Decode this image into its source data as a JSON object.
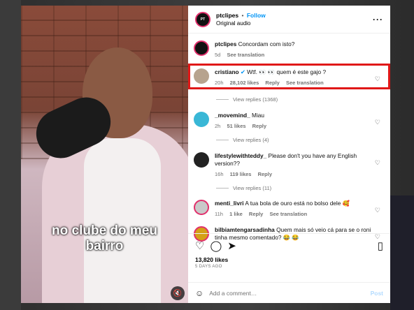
{
  "post": {
    "username": "ptclipes",
    "follow_label": "Follow",
    "audio": "Original audio",
    "avatar_text": "PT CLIPES",
    "caption_overlay_line1": "no clube do meu",
    "caption_overlay_line2": "bairro"
  },
  "comments": [
    {
      "user": "ptclipes",
      "text": "Concordam com isto?",
      "time": "5d",
      "likes": "",
      "reply": "",
      "translation": "See translation"
    },
    {
      "user": "cristiano",
      "verified": true,
      "text": "Wtf. 👀 👀 quem é este gajo ?",
      "time": "20h",
      "likes": "28,102 likes",
      "reply": "Reply",
      "translation": "See translation",
      "view_replies": "View replies (1368)"
    },
    {
      "user": "_movemind_",
      "text": "Miau",
      "time": "2h",
      "likes": "51 likes",
      "reply": "Reply",
      "view_replies": "View replies (4)"
    },
    {
      "user": "lifestylewithteddy_",
      "text": "Please don't you have any English version??",
      "time": "16h",
      "likes": "119 likes",
      "reply": "Reply",
      "view_replies": "View replies (11)"
    },
    {
      "user": "menti_livri",
      "text": "A tua bola de ouro está no bolso dele 🥰",
      "time": "11h",
      "likes": "1 like",
      "reply": "Reply",
      "translation": "See translation"
    },
    {
      "user": "bilbiamtengarsadinha",
      "text": "Quem mais só veio cá para se o roni tinha mesmo comentado? 😂 😂",
      "time": "",
      "likes": "",
      "reply": "",
      "translation": ""
    }
  ],
  "footer": {
    "likes": "13,820 likes",
    "date": "5 DAYS AGO",
    "add_comment_placeholder": "Add a comment…",
    "post_label": "Post"
  },
  "icons": [
    "heart-icon",
    "comment-icon",
    "share-icon",
    "save-icon",
    "emoji-icon",
    "more-icon",
    "mute-icon",
    "verified-icon"
  ],
  "colors": {
    "link": "#0095f6",
    "highlight": "#e01818",
    "muted": "#737373"
  }
}
